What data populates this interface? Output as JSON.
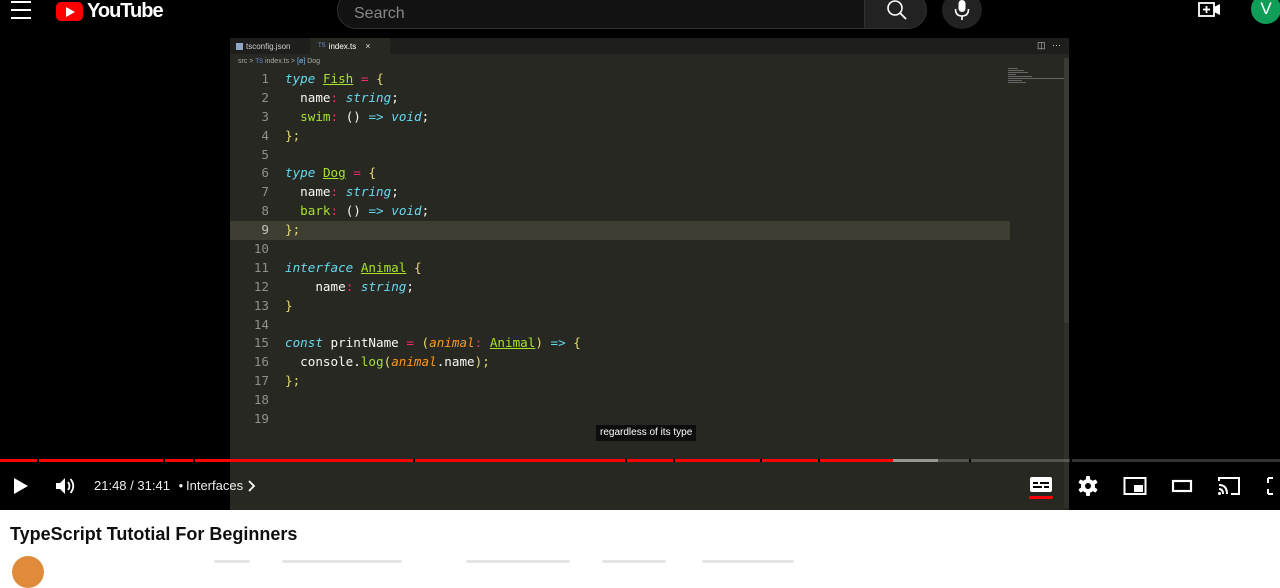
{
  "masthead": {
    "logo_text": "YouTube",
    "search_placeholder": "Search",
    "avatar_letter": "V",
    "colors": {
      "brand": "#ff0000",
      "avatar": "#0f9d58"
    }
  },
  "editor": {
    "tabs": [
      {
        "label": "tsconfig.json",
        "icon": "json-file-icon"
      },
      {
        "label": "index.ts",
        "icon": "ts-file-icon",
        "icon_text": "TS"
      }
    ],
    "breadcrumb": {
      "folder": "src",
      "sep": ">",
      "file_icon": "TS",
      "file": "index.ts",
      "symbol_icon": "[ø]",
      "symbol": "Dog"
    },
    "line_numbers": [
      "1",
      "2",
      "3",
      "4",
      "5",
      "6",
      "7",
      "8",
      "9",
      "10",
      "11",
      "12",
      "13",
      "14",
      "15",
      "16",
      "17",
      "18",
      "19"
    ],
    "current_line": 9,
    "code": {
      "type": "type",
      "fish": "Fish",
      "dog": "Dog",
      "eq": "=",
      "lbrace": "{",
      "rbrace": "}",
      "rbrace_semi": "};",
      "name": "name",
      "colon": ":",
      "string": "string",
      "semi": ";",
      "swim": "swim",
      "bark": "bark",
      "parens": "()",
      "arrow": "=>",
      "void": "void",
      "interface": "interface",
      "animal_type": "Animal",
      "const": "const",
      "printName": "printName",
      "lparen": "(",
      "rparen": ")",
      "animal_param": "animal",
      "console": "console",
      "dot": ".",
      "log": "log",
      "name_prop": "name",
      "rparen_semi": ");"
    }
  },
  "player": {
    "caption": "regardless of its type",
    "current_time": "21:48",
    "duration": "31:41",
    "time_separator": "/",
    "chapter_dot": "•",
    "chapter": "Interfaces",
    "played_fraction": 0.698,
    "buffered_fraction": 0.733,
    "chapter_gaps": [
      0.029,
      0.127,
      0.151,
      0.323,
      0.488,
      0.526,
      0.594,
      0.639,
      0.757,
      0.836
    ],
    "captions_on": true
  },
  "video": {
    "title": "TypeScript Tutotial For Beginners"
  }
}
